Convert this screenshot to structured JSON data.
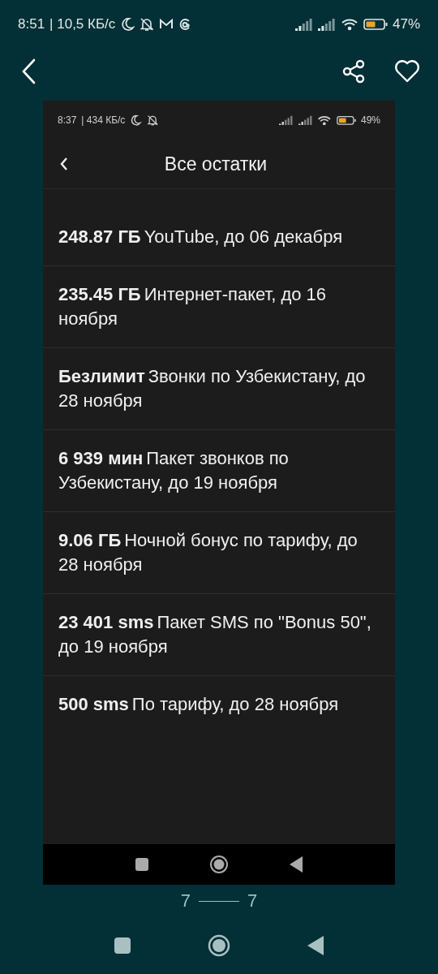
{
  "status_bar": {
    "time": "8:51",
    "speed": "| 10,5 КБ/с",
    "battery": "47%"
  },
  "screenshot": {
    "status_bar": {
      "time": "8:37",
      "speed": "| 434 КБ/с",
      "battery": "49%"
    },
    "title": "Все остатки",
    "items": [
      {
        "amount": "248.87 ГБ",
        "description": "YouTube, до 06 декабря"
      },
      {
        "amount": "235.45 ГБ",
        "description": "Интернет-пакет, до 16 ноября"
      },
      {
        "amount": "Безлимит",
        "description": "Звонки по Узбекистану, до 28 ноября"
      },
      {
        "amount": "6 939 мин",
        "description": "Пакет звонков по Узбекистану, до 19 ноября"
      },
      {
        "amount": "9.06 ГБ",
        "description": "Ночной бонус по тарифу, до 28 ноября"
      },
      {
        "amount": "23 401 sms",
        "description": "Пакет SMS по \"Bonus 50\", до 19 ноября"
      },
      {
        "amount": "500 sms",
        "description": "По тарифу, до 28 ноября"
      }
    ]
  },
  "pager": {
    "current": "7",
    "total": "7"
  }
}
